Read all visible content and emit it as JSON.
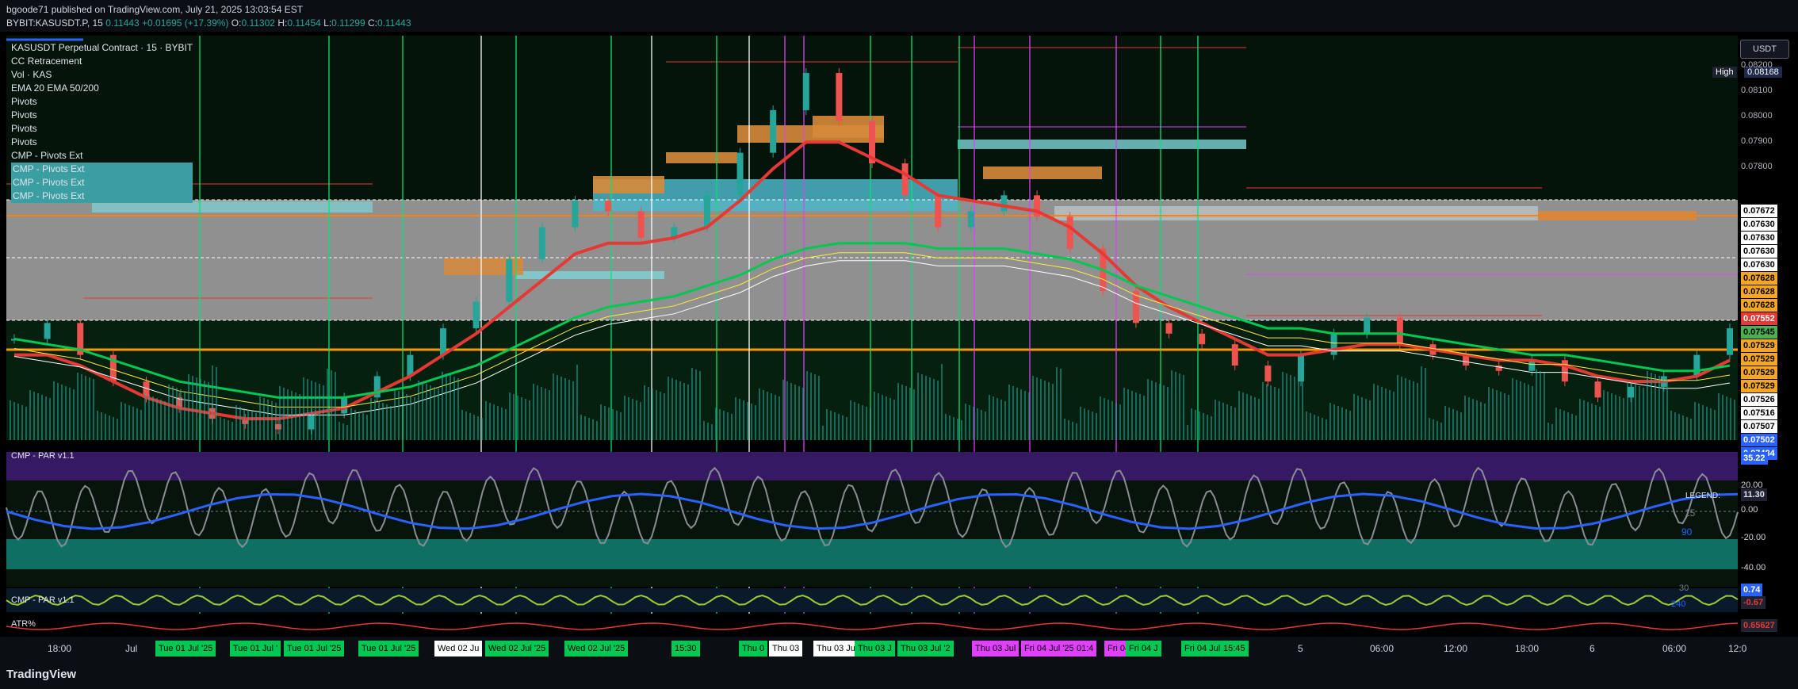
{
  "header": {
    "published": "bgoode71 published on TradingView.com, July 21, 2025 13:03:54 EST",
    "symbol": "BYBIT:KASUSDT.P, 15",
    "last": "0.11443",
    "change": "+0.01695 (+17.39%)",
    "o_label": "O:",
    "o": "0.11302",
    "h_label": "H:",
    "h": "0.11454",
    "l_label": "L:",
    "l": "0.11299",
    "c_label": "C:",
    "c": "0.11443"
  },
  "legend": [
    "KASUSDT Perpetual Contract · 15 · BYBIT",
    "CC Retracement",
    "Vol · KAS",
    "EMA 20 EMA 50/200",
    "Pivots",
    "Pivots",
    "Pivots",
    "Pivots",
    "CMP - Pivots Ext",
    "CMP - Pivots Ext",
    "CMP - Pivots Ext",
    "CMP - Pivots Ext"
  ],
  "currency_button": "USDT",
  "high_tag": "High",
  "high_value": "0.08168",
  "price_scale": [
    "0.08200",
    "0.08100",
    "0.08000",
    "0.07900",
    "0.07800"
  ],
  "price_badges": [
    {
      "v": "0.07672",
      "c": "#ffffff"
    },
    {
      "v": "0.07630",
      "c": "#ffffff"
    },
    {
      "v": "0.07630",
      "c": "#ffffff"
    },
    {
      "v": "0.07630",
      "c": "#ffffff"
    },
    {
      "v": "0.07630",
      "c": "#ffffff"
    },
    {
      "v": "0.07628",
      "c": "#f5a623"
    },
    {
      "v": "0.07628",
      "c": "#f5a623"
    },
    {
      "v": "0.07628",
      "c": "#f5a623"
    },
    {
      "v": "0.07552",
      "c": "#e53935"
    },
    {
      "v": "0.07545",
      "c": "#4caf50"
    },
    {
      "v": "0.07529",
      "c": "#f5a623"
    },
    {
      "v": "0.07529",
      "c": "#f5a623"
    },
    {
      "v": "0.07529",
      "c": "#f5a623"
    },
    {
      "v": "0.07529",
      "c": "#f5a623"
    },
    {
      "v": "0.07526",
      "c": "#ffffff"
    },
    {
      "v": "0.07516",
      "c": "#ffffff"
    },
    {
      "v": "0.07507",
      "c": "#ffffff"
    },
    {
      "v": "0.07502",
      "c": "#2962ff"
    },
    {
      "v": "0.07484",
      "c": "#2962ff"
    }
  ],
  "osc": {
    "title": "CMP - PAR v1.1",
    "scale": [
      "20.00",
      "0.00",
      "-20.00",
      "-40.00"
    ],
    "badge1": "35.22",
    "badge2": "11.30",
    "legend_label": "LEGEND:",
    "level_90": "90",
    "level_15": "15"
  },
  "osc2": {
    "title": "CMP - PAR v1.1",
    "badge": "0.74",
    "badge2": "-0.67",
    "num_240": "240",
    "num_30": "30"
  },
  "atr": {
    "title": "ATR%",
    "badge": "0.65627"
  },
  "time_labels": [
    {
      "t": "18:00",
      "bg": ""
    },
    {
      "t": "Jul",
      "bg": ""
    },
    {
      "t": "Tue 01 Jul '25",
      "bg": "#00c853"
    },
    {
      "t": "Tue 01 Jul '",
      "bg": "#00c853"
    },
    {
      "t": "Tue 01 Jul '25",
      "bg": "#00c853"
    },
    {
      "t": "Tue 01 Jul '25",
      "bg": "#00c853"
    },
    {
      "t": "Wed 02 Ju",
      "bg": "#ffffff"
    },
    {
      "t": "Wed 02 Jul '25",
      "bg": "#00c853"
    },
    {
      "t": "Wed 02 Jul '25",
      "bg": "#00c853"
    },
    {
      "t": "15:30",
      "bg": "#00c853"
    },
    {
      "t": "Thu 0",
      "bg": "#00c853"
    },
    {
      "t": "Thu 03",
      "bg": "#ffffff"
    },
    {
      "t": "Thu 03 Jul '25",
      "bg": "#ffffff"
    },
    {
      "t": "Thu 03 J",
      "bg": "#00c853"
    },
    {
      "t": "Thu 03 Jul '2",
      "bg": "#00c853"
    },
    {
      "t": "Thu 03 Jul",
      "bg": "#e040fb"
    },
    {
      "t": "Fri 04 Jul '25",
      "bg": "#e040fb"
    },
    {
      "t": "01:4",
      "bg": "#e040fb"
    },
    {
      "t": "Fri 04 Ju",
      "bg": "#e040fb"
    },
    {
      "t": "Fri 04 J",
      "bg": "#00c853"
    },
    {
      "t": "Fri 04 Jul '25",
      "bg": "#00c853"
    },
    {
      "t": "15:45",
      "bg": "#00c853"
    },
    {
      "t": "5",
      "bg": ""
    },
    {
      "t": "06:00",
      "bg": ""
    },
    {
      "t": "12:00",
      "bg": ""
    },
    {
      "t": "18:00",
      "bg": ""
    },
    {
      "t": "6",
      "bg": ""
    },
    {
      "t": "06:00",
      "bg": ""
    },
    {
      "t": "12:0",
      "bg": ""
    }
  ],
  "footer": {
    "logo": "TradingView"
  },
  "chart_data": {
    "type": "line",
    "title": "KASUSDT Perpetual Contract · 15 · BYBIT",
    "ylabel": "USDT",
    "ylim": [
      0.0746,
      0.0822
    ],
    "series": [
      {
        "name": "KASUSDT",
        "values": [
          0.0765,
          0.0768,
          0.0762,
          0.0757,
          0.0754,
          0.0752,
          0.075,
          0.0749,
          0.0748,
          0.0751,
          0.0754,
          0.0758,
          0.0762,
          0.0767,
          0.0772,
          0.078,
          0.0786,
          0.0791,
          0.0789,
          0.0784,
          0.0786,
          0.0792,
          0.08,
          0.0808,
          0.0815,
          0.0806,
          0.0798,
          0.0792,
          0.0786,
          0.0789,
          0.0792,
          0.0788,
          0.0782,
          0.0774,
          0.0768,
          0.0766,
          0.0764,
          0.076,
          0.0757,
          0.0762,
          0.0766,
          0.0769,
          0.0764,
          0.0762,
          0.076,
          0.0759,
          0.0761,
          0.0757,
          0.0754,
          0.0756,
          0.0758,
          0.0762,
          0.0767
        ]
      },
      {
        "name": "EMA 20",
        "values": [
          0.0762,
          0.0762,
          0.076,
          0.0757,
          0.0754,
          0.0752,
          0.0751,
          0.075,
          0.075,
          0.0751,
          0.0752,
          0.0755,
          0.0758,
          0.0762,
          0.0766,
          0.0771,
          0.0776,
          0.0781,
          0.0783,
          0.0783,
          0.0784,
          0.0786,
          0.0791,
          0.0797,
          0.0802,
          0.0802,
          0.0799,
          0.0796,
          0.0792,
          0.0791,
          0.079,
          0.0789,
          0.0786,
          0.0781,
          0.0775,
          0.0771,
          0.0768,
          0.0765,
          0.0762,
          0.0762,
          0.0763,
          0.0764,
          0.0764,
          0.0763,
          0.0762,
          0.0761,
          0.0761,
          0.076,
          0.0758,
          0.0757,
          0.0757,
          0.0758,
          0.0761
        ]
      },
      {
        "name": "EMA 50",
        "values": [
          0.0765,
          0.0764,
          0.0763,
          0.0761,
          0.0759,
          0.0757,
          0.0756,
          0.0755,
          0.0754,
          0.0754,
          0.0754,
          0.0755,
          0.0756,
          0.0758,
          0.076,
          0.0763,
          0.0766,
          0.0769,
          0.0771,
          0.0772,
          0.0773,
          0.0775,
          0.0777,
          0.078,
          0.0782,
          0.0783,
          0.0783,
          0.0783,
          0.0782,
          0.0782,
          0.0782,
          0.0781,
          0.078,
          0.0778,
          0.0775,
          0.0773,
          0.0771,
          0.0769,
          0.0767,
          0.0767,
          0.0766,
          0.0766,
          0.0766,
          0.0765,
          0.0764,
          0.0763,
          0.0762,
          0.0762,
          0.0761,
          0.076,
          0.0759,
          0.0759,
          0.076
        ]
      }
    ],
    "panels": [
      "price",
      "volume",
      "CMP - PAR v1.1",
      "CMP - PAR v1.1",
      "ATR%"
    ]
  }
}
